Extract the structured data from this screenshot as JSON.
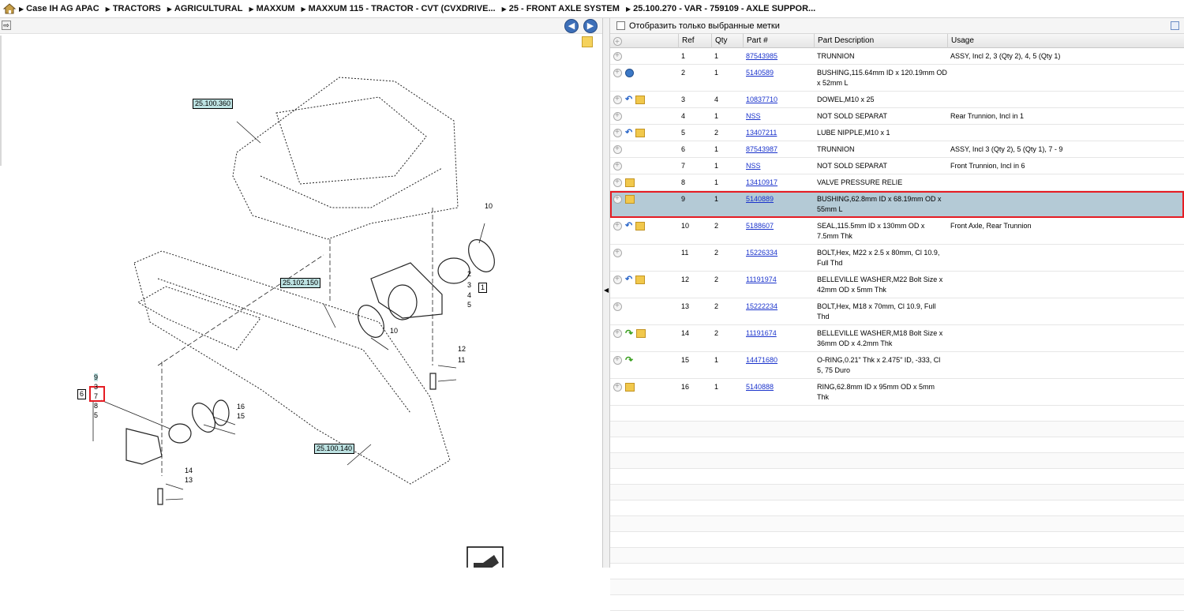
{
  "breadcrumb": [
    "Case IH AG APAC",
    "TRACTORS",
    "AGRICULTURAL",
    "MAXXUM",
    "MAXXUM 115 - TRACTOR - CVT (CVXDRIVE...",
    "25 - FRONT AXLE SYSTEM",
    "25.100.270 - VAR - 759109 - AXLE SUPPOR..."
  ],
  "filter_label": "Отобразить только выбранные метки",
  "columns": [
    "Ref",
    "Qty",
    "Part #",
    "Part Description",
    "Usage"
  ],
  "rows": [
    {
      "icons": [],
      "ref": "1",
      "qty": "1",
      "part": "87543985",
      "desc": "TRUNNION",
      "usage": "ASSY, Incl 2, 3 (Qty 2), 4, 5 (Qty 1)"
    },
    {
      "icons": [
        "globe"
      ],
      "ref": "2",
      "qty": "1",
      "part": "5140589",
      "desc": "BUSHING,115.64mm ID x 120.19mm OD x 52mm L",
      "usage": ""
    },
    {
      "icons": [
        "return",
        "box"
      ],
      "ref": "3",
      "qty": "4",
      "part": "10837710",
      "desc": "DOWEL,M10 x 25",
      "usage": ""
    },
    {
      "icons": [],
      "ref": "4",
      "qty": "1",
      "part": "NSS",
      "desc": "NOT SOLD SEPARAT",
      "usage": "Rear Trunnion, Incl in 1"
    },
    {
      "icons": [
        "return",
        "box"
      ],
      "ref": "5",
      "qty": "2",
      "part": "13407211",
      "desc": "LUBE NIPPLE,M10 x 1",
      "usage": ""
    },
    {
      "icons": [],
      "ref": "6",
      "qty": "1",
      "part": "87543987",
      "desc": "TRUNNION",
      "usage": "ASSY, Incl 3 (Qty 2), 5 (Qty 1), 7 - 9"
    },
    {
      "icons": [],
      "ref": "7",
      "qty": "1",
      "part": "NSS",
      "desc": "NOT SOLD SEPARAT",
      "usage": "Front Trunnion, Incl in 6"
    },
    {
      "icons": [
        "box"
      ],
      "ref": "8",
      "qty": "1",
      "part": "13410917",
      "desc": "VALVE PRESSURE RELIE",
      "usage": ""
    },
    {
      "icons": [
        "box"
      ],
      "ref": "9",
      "qty": "1",
      "part": "5140889",
      "desc": "BUSHING,62.8mm ID x 68.19mm OD x 55mm L",
      "usage": "",
      "selected": true
    },
    {
      "icons": [
        "return",
        "box"
      ],
      "ref": "10",
      "qty": "2",
      "part": "5188607",
      "desc": "SEAL,115.5mm ID x 130mm OD x 7.5mm Thk",
      "usage": "Front Axle, Rear Trunnion"
    },
    {
      "icons": [],
      "ref": "11",
      "qty": "2",
      "part": "15226334",
      "desc": "BOLT,Hex, M22 x 2.5 x 80mm, Cl 10.9, Full Thd",
      "usage": ""
    },
    {
      "icons": [
        "return",
        "box"
      ],
      "ref": "12",
      "qty": "2",
      "part": "11191974",
      "desc": "BELLEVILLE WASHER,M22 Bolt Size x 42mm OD x 5mm Thk",
      "usage": ""
    },
    {
      "icons": [],
      "ref": "13",
      "qty": "2",
      "part": "15222234",
      "desc": "BOLT,Hex, M18 x 70mm, Cl 10.9, Full Thd",
      "usage": ""
    },
    {
      "icons": [
        "green",
        "box"
      ],
      "ref": "14",
      "qty": "2",
      "part": "11191674",
      "desc": "BELLEVILLE WASHER,M18 Bolt Size x 36mm OD x 4.2mm Thk",
      "usage": ""
    },
    {
      "icons": [
        "green"
      ],
      "ref": "15",
      "qty": "1",
      "part": "14471680",
      "desc": "O-RING,0.21\" Thk x 2.475\" ID, -333, Cl 5, 75 Duro",
      "usage": ""
    },
    {
      "icons": [
        "box"
      ],
      "ref": "16",
      "qty": "1",
      "part": "5140888",
      "desc": "RING,62.8mm ID x 95mm OD x 5mm Thk",
      "usage": ""
    }
  ],
  "diagram": {
    "callouts": [
      "25.100.360",
      "25.102.150",
      "25.100.140"
    ],
    "labels": [
      "10",
      "1",
      "2",
      "3",
      "4",
      "5",
      "10",
      "12",
      "11",
      "6",
      "9",
      "3",
      "7",
      "8",
      "5",
      "16",
      "15",
      "14",
      "13"
    ]
  }
}
